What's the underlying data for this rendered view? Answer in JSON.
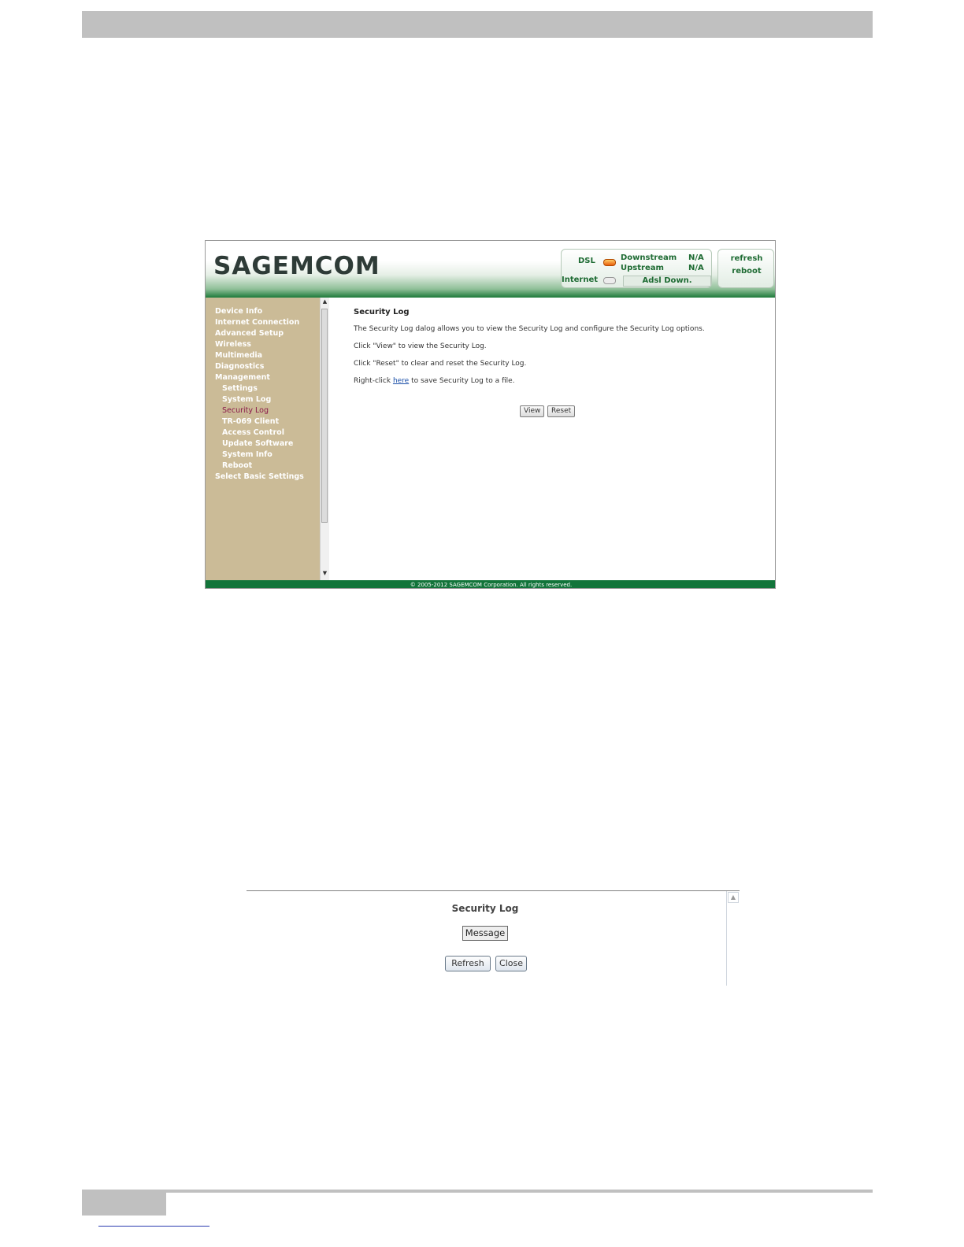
{
  "router_ui": {
    "logo": "SAGEMCOM",
    "status": {
      "dsl_label": "DSL",
      "internet_label": "Internet",
      "downstream_label": "Downstream",
      "downstream_value": "N/A",
      "upstream_label": "Upstream",
      "upstream_value": "N/A",
      "adsl_status": "Adsl Down."
    },
    "actions": {
      "refresh": "refresh",
      "reboot": "reboot"
    },
    "nav": [
      {
        "label": "Device Info"
      },
      {
        "label": "Internet Connection"
      },
      {
        "label": "Advanced Setup"
      },
      {
        "label": "Wireless"
      },
      {
        "label": "Multimedia"
      },
      {
        "label": "Diagnostics"
      },
      {
        "label": "Management"
      },
      {
        "label": "Settings"
      },
      {
        "label": "System Log"
      },
      {
        "label": "Security Log"
      },
      {
        "label": "TR-069 Client"
      },
      {
        "label": "Access Control"
      },
      {
        "label": "Update Software"
      },
      {
        "label": "System Info"
      },
      {
        "label": "Reboot"
      },
      {
        "label": "Select Basic Settings"
      }
    ],
    "content": {
      "title": "Security Log",
      "line1": "The Security Log dalog allows you to view the Security Log and configure the Security Log options.",
      "line2": "Click \"View\" to view the Security Log.",
      "line3": "Click \"Reset\" to clear and reset the Security Log.",
      "line4_prefix": "Right-click",
      "line4_link": "here",
      "line4_suffix": "to save Security Log to a file.",
      "view_button": "View",
      "reset_button": "Reset"
    },
    "footer": "© 2005-2012 SAGEMCOM Corporation. All rights reserved."
  },
  "security_log_popup": {
    "title": "Security Log",
    "column_header": "Message",
    "refresh_button": "Refresh",
    "close_button": "Close"
  }
}
